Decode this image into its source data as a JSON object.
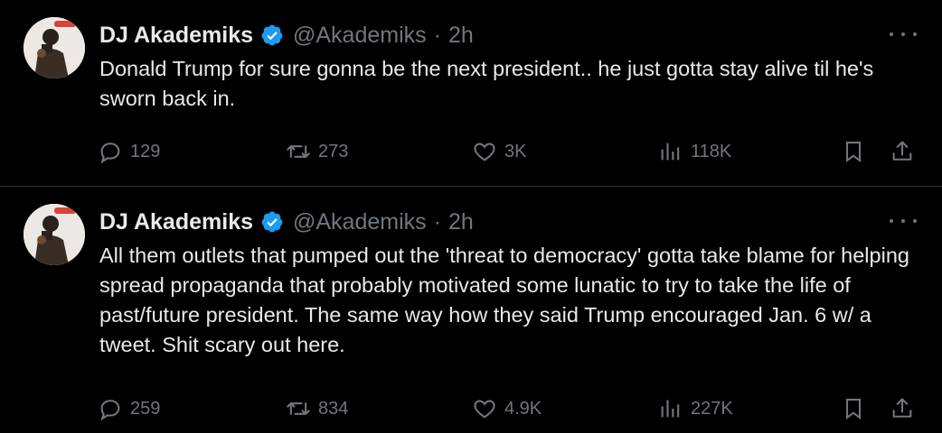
{
  "tweets": [
    {
      "name": "DJ Akademiks",
      "handle": "@Akademiks",
      "separator": "·",
      "time": "2h",
      "text": "Donald Trump for sure gonna be the next president.. he just gotta stay alive til he's sworn back in.",
      "replies": "129",
      "retweets": "273",
      "likes": "3K",
      "views": "118K"
    },
    {
      "name": "DJ Akademiks",
      "handle": "@Akademiks",
      "separator": "·",
      "time": "2h",
      "text": "All them outlets that pumped out the 'threat to democracy' gotta take blame for helping spread propaganda that probably motivated some lunatic to try to take the life of past/future president. The same way how they said Trump encouraged Jan. 6 w/ a tweet. Shit scary out here.",
      "replies": "259",
      "retweets": "834",
      "likes": "4.9K",
      "views": "227K"
    }
  ],
  "colors": {
    "background": "#000000",
    "text": "#e7e9ea",
    "secondary": "#71767b",
    "verified": "#1d9bf0",
    "divider": "#2f3336"
  },
  "icons": [
    "verified-badge-icon",
    "more-icon",
    "reply-icon",
    "retweet-icon",
    "like-icon",
    "views-icon",
    "bookmark-icon",
    "share-icon"
  ]
}
